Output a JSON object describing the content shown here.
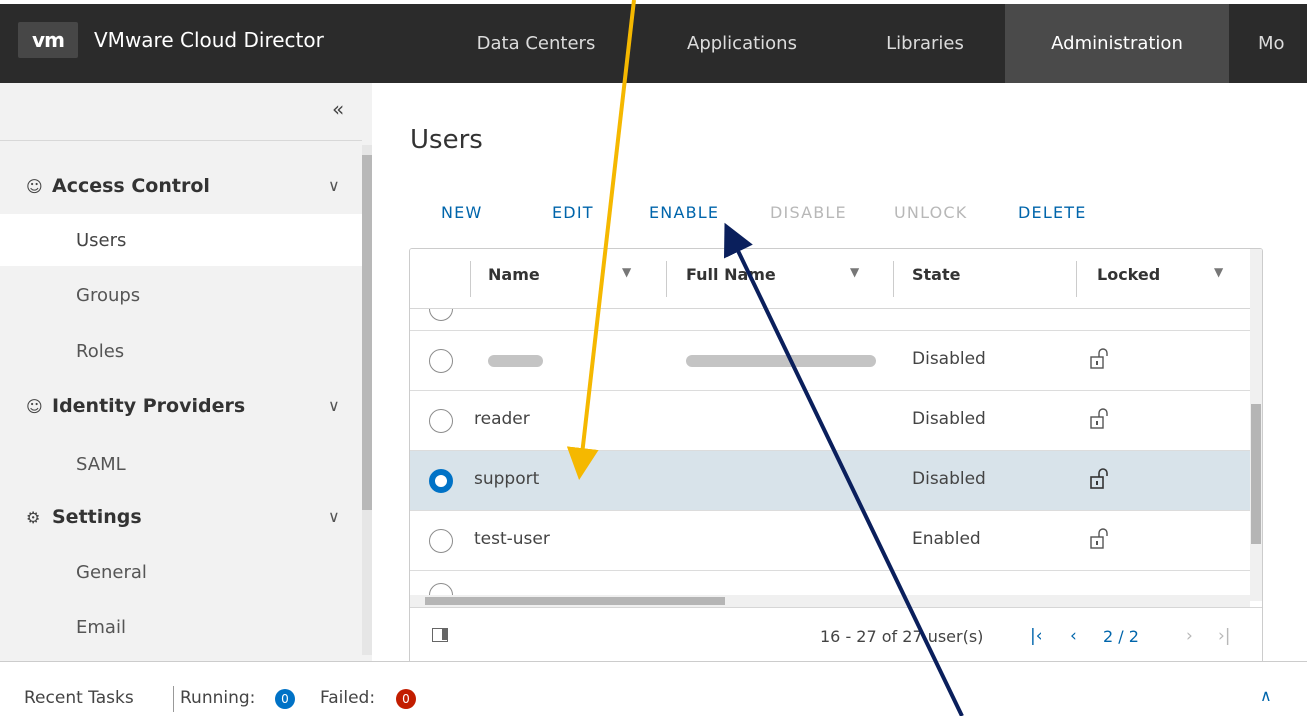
{
  "header": {
    "logo": "vm",
    "app_title": "VMware Cloud Director",
    "nav": [
      "Data Centers",
      "Applications",
      "Libraries",
      "Administration",
      "Mo"
    ],
    "active_nav": "Administration"
  },
  "sidebar": {
    "collapse_icon": "double-chevron-left-icon",
    "sections": [
      {
        "label": "Access Control",
        "icon": "users-icon",
        "items": [
          "Users",
          "Groups",
          "Roles"
        ]
      },
      {
        "label": "Identity Providers",
        "icon": "user-gear-icon",
        "items": [
          "SAML"
        ]
      },
      {
        "label": "Settings",
        "icon": "gear-icon",
        "items": [
          "General",
          "Email"
        ]
      }
    ],
    "active_item": "Users"
  },
  "main": {
    "title": "Users",
    "actions": [
      {
        "label": "NEW",
        "enabled": true
      },
      {
        "label": "EDIT",
        "enabled": true
      },
      {
        "label": "ENABLE",
        "enabled": true
      },
      {
        "label": "DISABLE",
        "enabled": false
      },
      {
        "label": "UNLOCK",
        "enabled": false
      },
      {
        "label": "DELETE",
        "enabled": true
      }
    ],
    "grid": {
      "columns": [
        "Name",
        "Full Name",
        "State",
        "Locked"
      ],
      "rows": [
        {
          "name": "",
          "full_name": "",
          "state": "Disabled",
          "locked": "unlocked",
          "selected": false,
          "redacted": true
        },
        {
          "name": "reader",
          "full_name": "",
          "state": "Disabled",
          "locked": "unlocked",
          "selected": false,
          "redacted": false
        },
        {
          "name": "support",
          "full_name": "",
          "state": "Disabled",
          "locked": "unlocked",
          "selected": true,
          "redacted": false
        },
        {
          "name": "test-user",
          "full_name": "",
          "state": "Enabled",
          "locked": "unlocked",
          "selected": false,
          "redacted": false
        }
      ],
      "footer": {
        "range": "16 - 27 of 27 user(s)",
        "page": "2 / 2"
      }
    }
  },
  "bottom": {
    "recent_tasks": "Recent Tasks",
    "running_label": "Running:",
    "running_count": "0",
    "failed_label": "Failed:",
    "failed_count": "0"
  },
  "colors": {
    "link": "#0065ab",
    "selected_row": "#d8e3ea",
    "annotation_yellow": "#f5b800",
    "annotation_navy": "#0a1f5c",
    "running_badge": "#0072c6",
    "failed_badge": "#c21d00"
  }
}
